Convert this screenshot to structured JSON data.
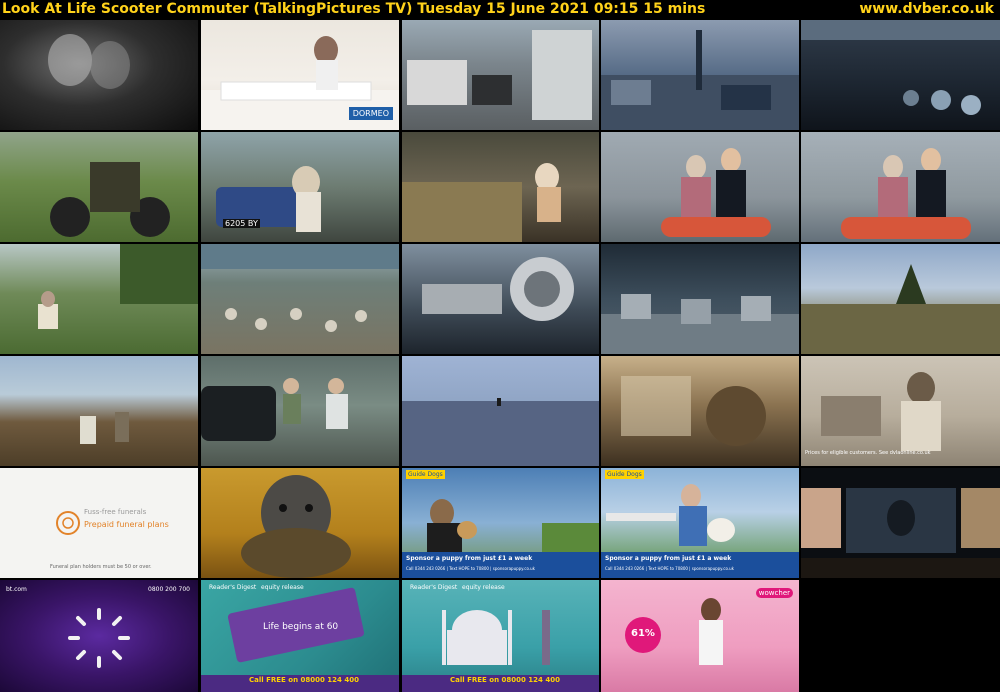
{
  "header": {
    "title": "Look At Life Scooter Commuter (TalkingPictures TV)    Tuesday 15 June 2021  09:15  15 mins",
    "site": "www.dvber.co.uk"
  },
  "thumbnails": [
    {
      "id": "r1c1",
      "label": "Couple in dark interior"
    },
    {
      "id": "r1c2",
      "label": "Dormeo mattress advert",
      "overlay": "DORMEO"
    },
    {
      "id": "r1c3",
      "label": "Parked cars street scene"
    },
    {
      "id": "r1c4",
      "label": "City car park with statue"
    },
    {
      "id": "r1c5",
      "label": "Scooters parked under arcade"
    },
    {
      "id": "r2c1",
      "label": "Rider on scooter in field"
    },
    {
      "id": "r2c2",
      "label": "Woman walking beside car",
      "overlay": "6205 BY"
    },
    {
      "id": "r2c3",
      "label": "Woman at market stall"
    },
    {
      "id": "r2c4",
      "label": "Couple riding scooter"
    },
    {
      "id": "r2c5",
      "label": "Couple riding scooter close-up"
    },
    {
      "id": "r3c1",
      "label": "Scooter riders on country lane"
    },
    {
      "id": "r3c2",
      "label": "Crowd of scooter riders"
    },
    {
      "id": "r3c3",
      "label": "Scooter engine close-up"
    },
    {
      "id": "r3c4",
      "label": "Scooter factory floor"
    },
    {
      "id": "r3c5",
      "label": "Hillside trail"
    },
    {
      "id": "r4c1",
      "label": "Riders on heathland"
    },
    {
      "id": "r4c2",
      "label": "Old car and cyclists"
    },
    {
      "id": "r4c3",
      "label": "Empty road at dusk"
    },
    {
      "id": "r4c4",
      "label": "Sepia vintage machinery"
    },
    {
      "id": "r4c5",
      "label": "Sepia woman at typewriter",
      "overlay": "Prices for eligible customers. See dvlaonline.co.uk"
    },
    {
      "id": "r5c1",
      "label": "Funeral plan advert",
      "overlay": "Fuss-free funerals",
      "overlay2": "Prepaid funeral plans",
      "overlay3": "Funeral plan holders must be 50 or over."
    },
    {
      "id": "r5c2",
      "label": "Dog puppet on sofa"
    },
    {
      "id": "r5c3",
      "label": "Guide Dogs advert with man and dog",
      "overlay": "Guide Dogs",
      "overlay2": "Sponsor a puppy from just £1 a week",
      "overlay3": "Call 0344 243 0266 | Text HOPE to 70800 | sponsorapuppy.co.uk"
    },
    {
      "id": "r5c4",
      "label": "Guide Dogs advert on bench",
      "overlay": "Guide Dogs",
      "overlay2": "Sponsor a puppy from just £1 a week",
      "overlay3": "Call 0344 243 0266 | Text HOPE to 70800 | sponsorapuppy.co.uk"
    },
    {
      "id": "r5c5",
      "label": "Streaming film collage"
    },
    {
      "id": "r6c1",
      "label": "BT loading advert",
      "overlay": "bt.com",
      "overlay2": "0800 200 700"
    },
    {
      "id": "r6c2",
      "label": "Reader's Digest equity release advert",
      "overlay": "Reader's Digest",
      "overlay2": "equity release",
      "overlay3": "Life begins at 60",
      "overlay4": "Call FREE on 08000 124 400"
    },
    {
      "id": "r6c3",
      "label": "Reader's Digest Taj Mahal advert",
      "overlay": "Reader's Digest",
      "overlay2": "equity release",
      "overlay3": "Call FREE on 08000 124 400"
    },
    {
      "id": "r6c4",
      "label": "Wowcher fitness advert",
      "overlay": "61%",
      "overlay2": "wowcher"
    }
  ],
  "colors": {
    "header_text": "#ffd21a",
    "background": "#000000"
  }
}
